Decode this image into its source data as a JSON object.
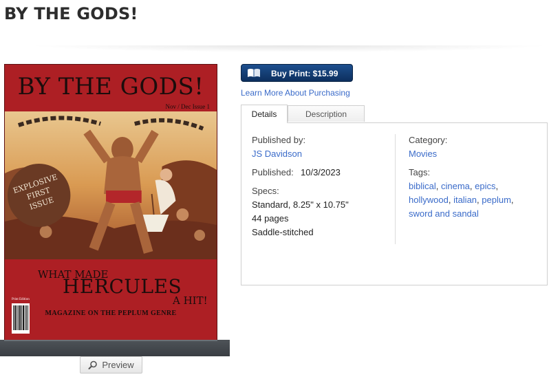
{
  "page": {
    "title": "BY THE GODS!"
  },
  "cover": {
    "title": "BY THE GODS!",
    "issue": "Nov / Dec Issue 1",
    "badge_line1": "EXPLOSIVE",
    "badge_line2": "FIRST",
    "badge_line3": "ISSUE",
    "headline_1": "WHAT MADE",
    "headline_2": "HERCULES",
    "headline_3": "A HIT!",
    "headline_4": "MAGAZINE ON THE PEPLUM GENRE",
    "print_edition": "Print Edition",
    "background_color": "#ad1f24"
  },
  "preview": {
    "label": "Preview",
    "icon": "magnifier-icon"
  },
  "purchase": {
    "buy_label": "Buy Print: $15.99",
    "buy_icon": "book-icon",
    "learn_more": "Learn More About Purchasing",
    "button_color": "#0d2f5e",
    "link_color": "#3a6bc9"
  },
  "tabs": [
    {
      "label": "Details",
      "active": true
    },
    {
      "label": "Description",
      "active": false
    }
  ],
  "details": {
    "published_by_label": "Published by:",
    "author": "JS Davidson",
    "published_label": "Published:",
    "published_date": "10/3/2023",
    "specs_label": "Specs:",
    "specs_size": "Standard, 8.25\" x 10.75\"",
    "specs_pages": "44 pages",
    "specs_binding": "Saddle-stitched",
    "category_label": "Category:",
    "category": "Movies",
    "tags_label": "Tags:",
    "tags": [
      "biblical",
      "cinema",
      "epics",
      "hollywood",
      "italian",
      "peplum",
      "sword and sandal"
    ]
  }
}
